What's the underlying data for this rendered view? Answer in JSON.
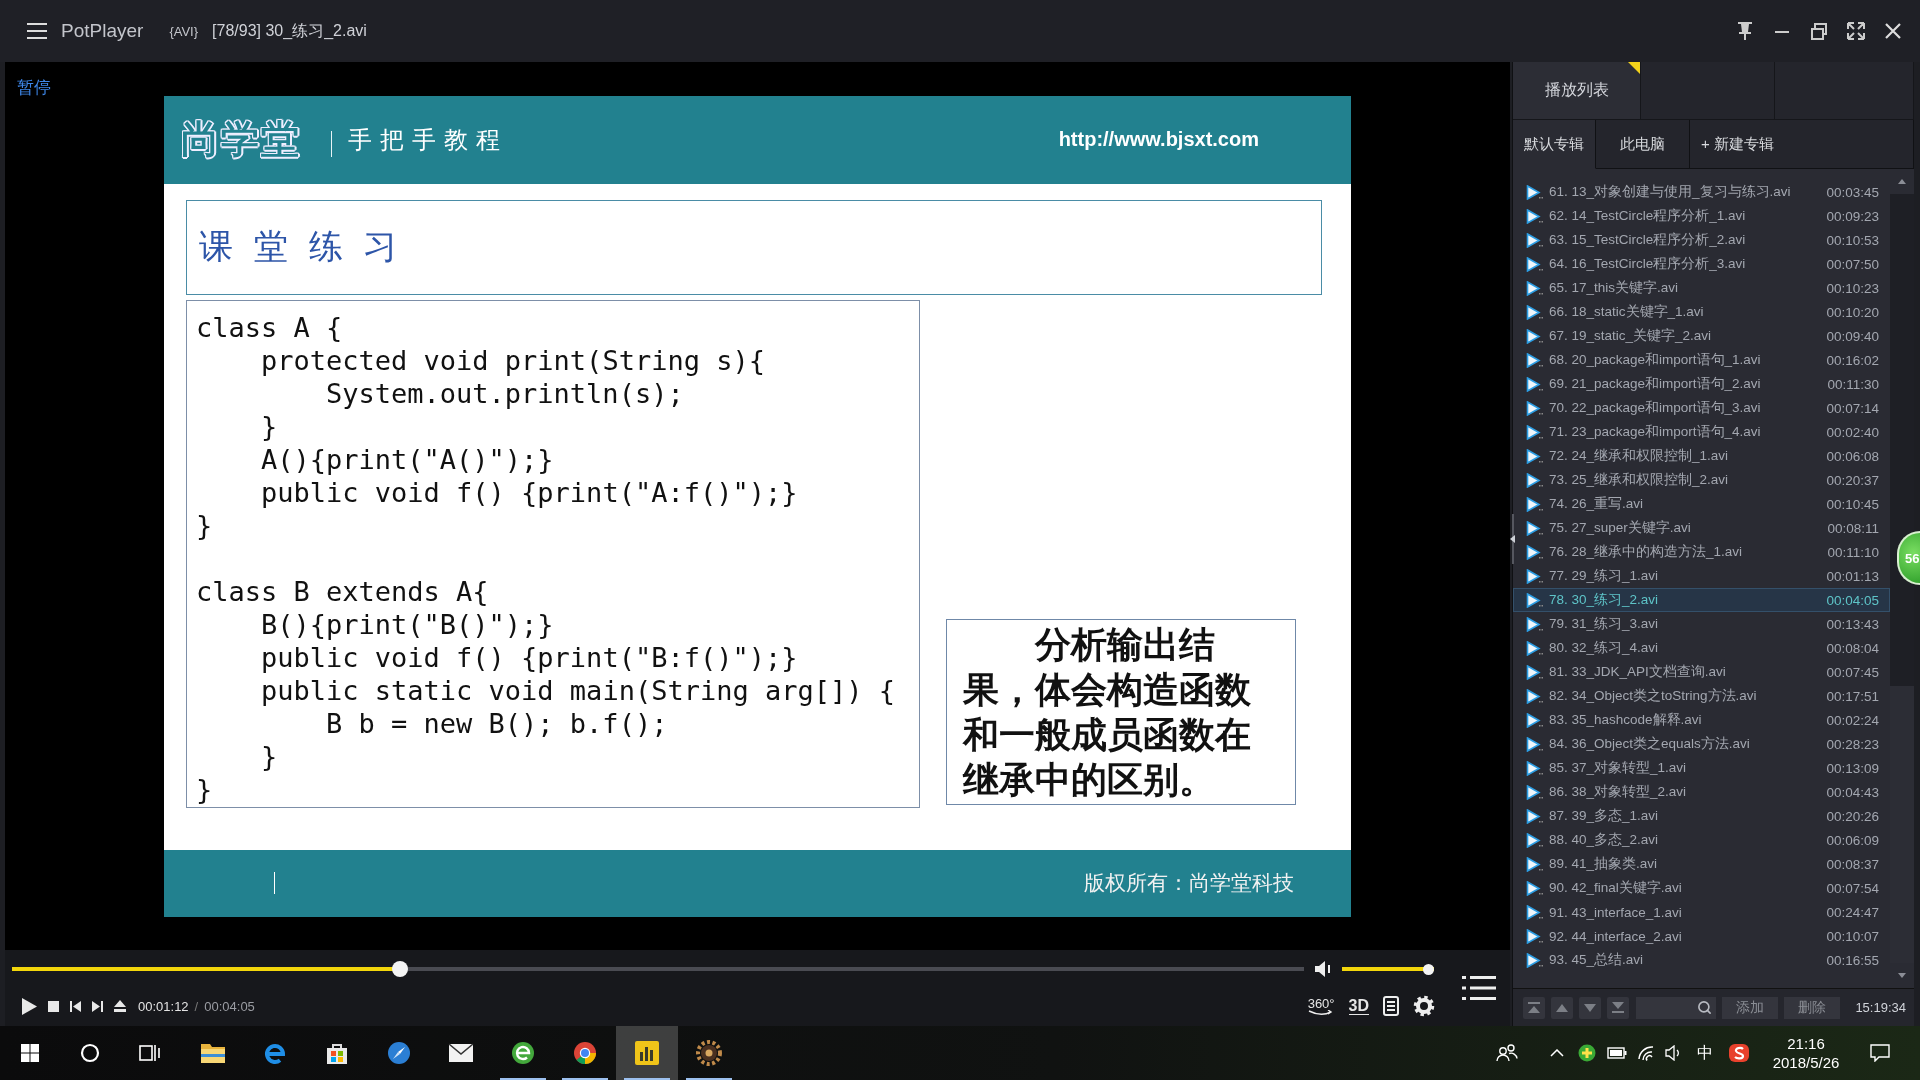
{
  "title_bar": {
    "app_name": "PotPlayer",
    "format": "{AVI}",
    "file": "[78/93] 30_练习_2.avi"
  },
  "video": {
    "status": "暂停",
    "slide": {
      "logo": "尚学堂",
      "subtitle": "手把手教程",
      "url": "http://www.bjsxt.com",
      "heading": "课 堂 练 习",
      "code_blocks": [
        [
          {
            "text": "class A {",
            "children": [
              {
                "text": "protected void print(String s){",
                "children": [
                  {
                    "text": "System.out.println(s);"
                  }
                ]
              },
              {
                "text": "}"
              },
              {
                "text": "A(){print(\"A()\");}"
              },
              {
                "text": "public void f() {print(\"A:f()\");}"
              }
            ]
          },
          {
            "text": "}"
          }
        ],
        [
          {
            "text": "class B extends A{",
            "children": [
              {
                "text": "B(){print(\"B()\");}"
              },
              {
                "text": "public void f() {print(\"B:f()\");}"
              },
              {
                "text": "public static void main(String arg[]) {",
                "children": [
                  {
                    "text": "B b = new B(); b.f();"
                  }
                ]
              },
              {
                "text": "}"
              }
            ]
          },
          {
            "text": "}"
          }
        ]
      ],
      "note": "分析输出结果，体会构造函数和一般成员函数在继承中的区别。",
      "copyright": "版权所有：尚学堂科技"
    }
  },
  "seek": {
    "level": 0.298
  },
  "volume": {
    "level": 1
  },
  "controls": {
    "elapsed": "00:01:12",
    "separator": "/",
    "duration": "00:04:05",
    "vr_label": "360°",
    "stereo_label": "3D"
  },
  "playlist": {
    "tabs": [
      {
        "label": "播放列表",
        "selected": true
      }
    ],
    "albums": [
      {
        "label": "默认专辑",
        "selected": true
      },
      {
        "label": "此电脑",
        "selected": false
      },
      {
        "label": "+ 新建专辑",
        "selected": false
      }
    ],
    "items": [
      {
        "title": "61. 13_对象创建与使用_复习与练习.avi",
        "duration": "00:03:45",
        "selected": false
      },
      {
        "title": "62. 14_TestCircle程序分析_1.avi",
        "duration": "00:09:23",
        "selected": false
      },
      {
        "title": "63. 15_TestCircle程序分析_2.avi",
        "duration": "00:10:53",
        "selected": false
      },
      {
        "title": "64. 16_TestCircle程序分析_3.avi",
        "duration": "00:07:50",
        "selected": false
      },
      {
        "title": "65. 17_this关键字.avi",
        "duration": "00:10:23",
        "selected": false
      },
      {
        "title": "66. 18_static关键字_1.avi",
        "duration": "00:10:20",
        "selected": false
      },
      {
        "title": "67. 19_static_关键字_2.avi",
        "duration": "00:09:40",
        "selected": false
      },
      {
        "title": "68. 20_package和import语句_1.avi",
        "duration": "00:16:02",
        "selected": false
      },
      {
        "title": "69. 21_package和import语句_2.avi",
        "duration": "00:11:30",
        "selected": false
      },
      {
        "title": "70. 22_package和import语句_3.avi",
        "duration": "00:07:14",
        "selected": false
      },
      {
        "title": "71. 23_package和import语句_4.avi",
        "duration": "00:02:40",
        "selected": false
      },
      {
        "title": "72. 24_继承和权限控制_1.avi",
        "duration": "00:06:08",
        "selected": false
      },
      {
        "title": "73. 25_继承和权限控制_2.avi",
        "duration": "00:20:37",
        "selected": false
      },
      {
        "title": "74. 26_重写.avi",
        "duration": "00:10:45",
        "selected": false
      },
      {
        "title": "75. 27_super关键字.avi",
        "duration": "00:08:11",
        "selected": false
      },
      {
        "title": "76. 28_继承中的构造方法_1.avi",
        "duration": "00:11:10",
        "selected": false
      },
      {
        "title": "77. 29_练习_1.avi",
        "duration": "00:01:13",
        "selected": false
      },
      {
        "title": "78. 30_练习_2.avi",
        "duration": "00:04:05",
        "selected": true
      },
      {
        "title": "79. 31_练习_3.avi",
        "duration": "00:13:43",
        "selected": false
      },
      {
        "title": "80. 32_练习_4.avi",
        "duration": "00:08:04",
        "selected": false
      },
      {
        "title": "81. 33_JDK_API文档查询.avi",
        "duration": "00:07:45",
        "selected": false
      },
      {
        "title": "82. 34_Object类之toString方法.avi",
        "duration": "00:17:51",
        "selected": false
      },
      {
        "title": "83. 35_hashcode解释.avi",
        "duration": "00:02:24",
        "selected": false
      },
      {
        "title": "84. 36_Object类之equals方法.avi",
        "duration": "00:28:23",
        "selected": false
      },
      {
        "title": "85. 37_对象转型_1.avi",
        "duration": "00:13:09",
        "selected": false
      },
      {
        "title": "86. 38_对象转型_2.avi",
        "duration": "00:04:43",
        "selected": false
      },
      {
        "title": "87. 39_多态_1.avi",
        "duration": "00:20:26",
        "selected": false
      },
      {
        "title": "88. 40_多态_2.avi",
        "duration": "00:06:09",
        "selected": false
      },
      {
        "title": "89. 41_抽象类.avi",
        "duration": "00:08:37",
        "selected": false
      },
      {
        "title": "90. 42_final关键字.avi",
        "duration": "00:07:54",
        "selected": false
      },
      {
        "title": "91. 43_interface_1.avi",
        "duration": "00:24:47",
        "selected": false
      },
      {
        "title": "92. 44_interface_2.avi",
        "duration": "00:10:07",
        "selected": false
      },
      {
        "title": "93. 45_总结.avi",
        "duration": "00:16:55",
        "selected": false
      }
    ],
    "toolbar": {
      "add": "添加",
      "delete": "删除",
      "time": "15:19:34"
    }
  },
  "counter_badge": {
    "value": "56"
  },
  "taskbar": {
    "apps": [
      {
        "kind": "folder",
        "running": false,
        "active": false
      },
      {
        "kind": "edge",
        "running": false,
        "active": false
      },
      {
        "kind": "store",
        "running": false,
        "active": false
      },
      {
        "kind": "compass",
        "running": false,
        "active": false
      },
      {
        "kind": "mail",
        "running": false,
        "active": false
      },
      {
        "kind": "globe",
        "running": true,
        "active": false
      },
      {
        "kind": "chrome",
        "running": true,
        "active": false
      },
      {
        "kind": "chart",
        "running": true,
        "active": true
      },
      {
        "kind": "gear",
        "running": true,
        "active": false
      }
    ],
    "ime": "中",
    "time": "21:16",
    "date": "2018/5/26"
  }
}
